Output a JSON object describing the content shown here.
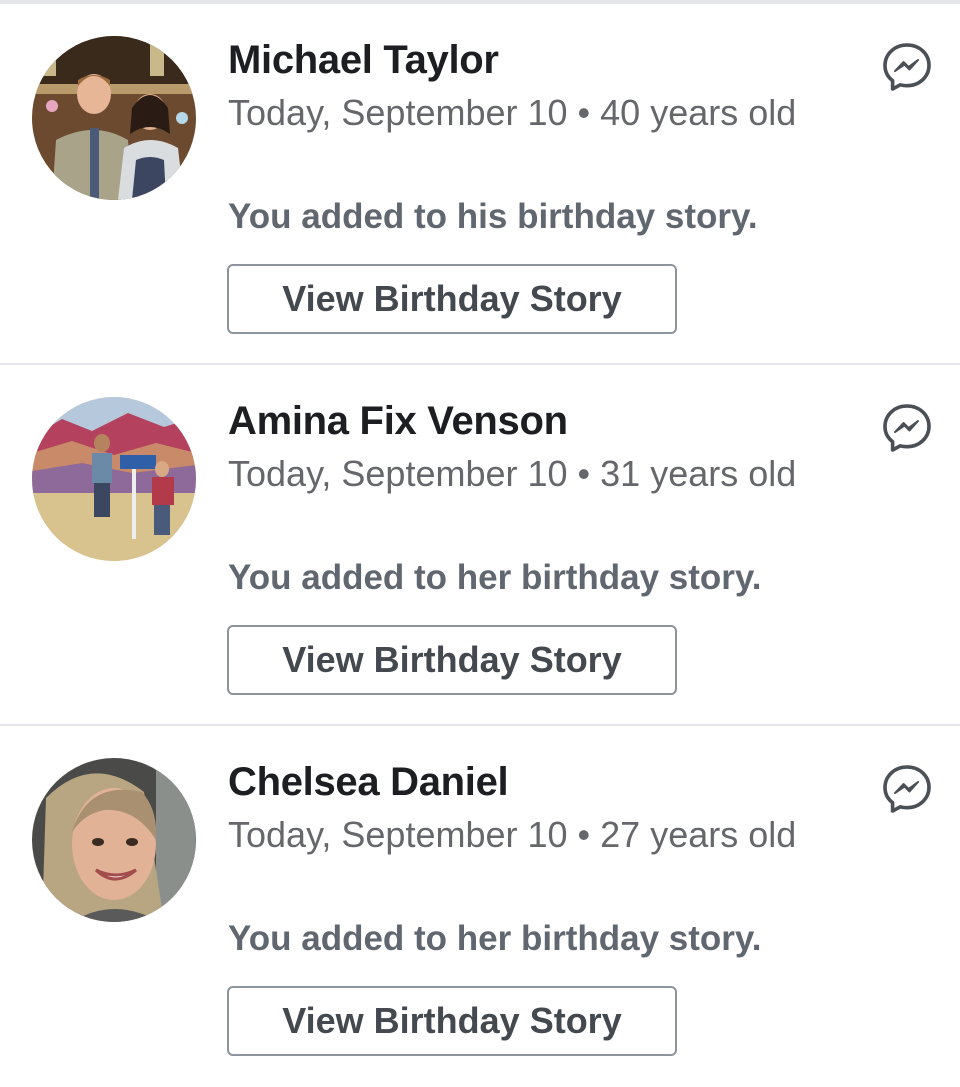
{
  "birthdays": [
    {
      "name": "Michael Taylor",
      "date_line": "Today, September 10 • 40 years old",
      "story_note": "You added to his birthday story.",
      "button_label": "View Birthday Story"
    },
    {
      "name": "Amina Fix Venson",
      "date_line": "Today, September 10 • 31 years old",
      "story_note": "You added to her birthday story.",
      "button_label": "View Birthday Story"
    },
    {
      "name": "Chelsea Daniel",
      "date_line": "Today, September 10 • 27 years old",
      "story_note": "You added to her birthday story.",
      "button_label": "View Birthday Story"
    }
  ],
  "icons": {
    "messenger": "messenger-icon",
    "avatar": "profile-photo"
  },
  "colors": {
    "name_text": "#1c1e21",
    "secondary_text": "#65676b",
    "divider": "#e4e6ea",
    "button_border": "#8d949e"
  }
}
